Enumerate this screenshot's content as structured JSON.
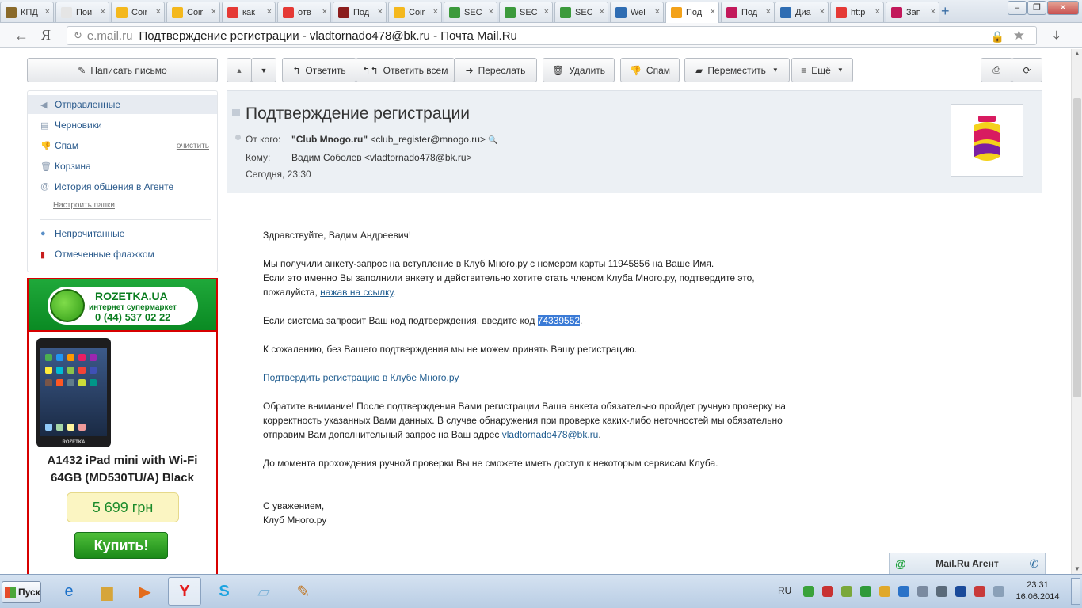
{
  "browser": {
    "tabs": [
      {
        "label": "КПД",
        "fav": "#8a6a2a"
      },
      {
        "label": "Пои",
        "fav": "#e5e5e5"
      },
      {
        "label": "Coir",
        "fav": "#f4b81d"
      },
      {
        "label": "Coir",
        "fav": "#f4b81d"
      },
      {
        "label": "как",
        "fav": "#e53935"
      },
      {
        "label": "отв",
        "fav": "#e53935"
      },
      {
        "label": "Под",
        "fav": "#8b1d1d"
      },
      {
        "label": "Coir",
        "fav": "#f4b81d"
      },
      {
        "label": "SEC",
        "fav": "#3c9a3c"
      },
      {
        "label": "SEC",
        "fav": "#3c9a3c"
      },
      {
        "label": "SEC",
        "fav": "#3c9a3c"
      },
      {
        "label": "Wel",
        "fav": "#2f6db3"
      },
      {
        "label": "Под",
        "fav": "#f3a21a"
      },
      {
        "label": "Под",
        "fav": "#c2185b"
      },
      {
        "label": "Диа",
        "fav": "#2f6db3"
      },
      {
        "label": "http",
        "fav": "#e53935"
      },
      {
        "label": "Зап",
        "fav": "#c2185b"
      }
    ],
    "tab_close": "×",
    "new_tab": "+",
    "address_host": "e.mail.ru",
    "address_title": "Подтверждение регистрации - vladtornado478@bk.ru - Почта Mail.Ru",
    "yandex_logo": "Я"
  },
  "toolbar": {
    "compose": "Написать письмо",
    "reply": "Ответить",
    "reply_all": "Ответить всем",
    "forward": "Переслать",
    "delete": "Удалить",
    "spam": "Спам",
    "move": "Переместить",
    "more": "Ещё"
  },
  "folders": {
    "items": [
      {
        "label": "Отправленные",
        "icon": "sent-icon"
      },
      {
        "label": "Черновики",
        "icon": "drafts-icon"
      },
      {
        "label": "Спам",
        "icon": "spam-icon"
      },
      {
        "label": "Корзина",
        "icon": "trash-icon"
      },
      {
        "label": "История общения в Агенте",
        "icon": "agent-history-icon"
      }
    ],
    "clean_label": "очистить",
    "setup": "Настроить папки",
    "unread": "Непрочитанные",
    "flagged": "Отмеченные флажком"
  },
  "ad": {
    "brand": "ROZETKA.UA",
    "subtitle": "интернет супермаркет",
    "phone": "0 (44) 537 02 22",
    "device_label": "ROZETKA",
    "product_line1": "A1432 iPad mini with Wi-Fi",
    "product_line2": "64GB (MD530TU/A) Black",
    "price": "5 699 грн",
    "buy": "Купить!"
  },
  "message": {
    "subject": "Подтверждение регистрации",
    "from_label": "От кого:",
    "from_name": "\"Club Mnogo.ru\"",
    "from_email": "<club_register@mnogo.ru>",
    "to_label": "Кому:",
    "to_value": "Вадим Соболев <vladtornado478@bk.ru>",
    "date": "Сегодня, 23:30",
    "greeting": "Здравствуйте, Вадим Андреевич!",
    "p1_line1": "Мы получили анкету-запрос на вступление в Клуб Много.ру с номером карты 11945856 на Ваше Имя.",
    "p1_line2": "Если это именно Вы заполнили анкету и действительно хотите стать членом Клуба Много.ру, подтвердите это,",
    "p1_line3_pre": "пожалуйста, ",
    "p1_link": "нажав на ссылку",
    "p1_line3_post": ".",
    "code_pre": "Если система запросит Ваш код подтверждения, введите код ",
    "code": "74339552",
    "code_post": ".",
    "regret": "К сожалению, без Вашего подтверждения мы не можем принять Вашу регистрацию.",
    "confirm_link": "Подтвердить регистрацию в Клубе Много.ру",
    "notice_line1": "Обратите внимание! После подтверждения Вами регистрации Ваша анкета обязательно пройдет ручную проверку на",
    "notice_line2": "корректность указанных Вами данных. В случае обнаружения при проверке каких-либо неточностей мы обязательно",
    "notice_line3_pre": "отправим Вам дополнительный запрос на Ваш адрес ",
    "notice_email": "vladtornado478@bk.ru",
    "notice_line3_post": ".",
    "until": "До момента прохождения ручной проверки Вы не сможете иметь доступ к некоторым сервисам Клуба.",
    "regards": "С уважением,",
    "signature": "Клуб Много.ру"
  },
  "agent": {
    "title": "Mail.Ru Агент",
    "at": "@",
    "call": "✆"
  },
  "taskbar": {
    "start": "Пуск",
    "lang": "RU",
    "time": "23:31",
    "date": "16.06.2014"
  },
  "colors": {
    "accent": "#2a5a8c",
    "ad_green": "#0a8a23",
    "ad_red": "#d70000",
    "highlight": "#3b7bd6"
  }
}
